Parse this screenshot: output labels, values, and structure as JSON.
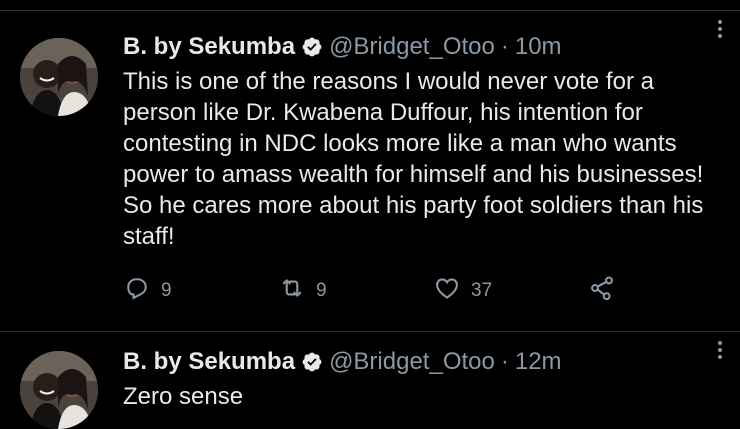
{
  "tweets": [
    {
      "display_name": "B. by Sekumba",
      "handle": "@Bridget_Otoo",
      "separator": "·",
      "time": "10m",
      "text": "This is one of the reasons I would never vote for a person like Dr. Kwabena Duffour, his intention for contesting in NDC looks more like a man who wants power to amass wealth for himself and his businesses! So he cares more about his party foot soldiers than his staff!",
      "replies": "9",
      "retweets": "9",
      "likes": "37"
    },
    {
      "display_name": "B. by Sekumba",
      "handle": "@Bridget_Otoo",
      "separator": "·",
      "time": "12m",
      "text": "Zero sense"
    }
  ],
  "colors": {
    "background": "#000000",
    "text": "#e7e9ea",
    "muted": "#8b98a5",
    "divider": "#2f3336",
    "verified_badge": "#e7e9ea"
  },
  "icons": [
    "verified-icon",
    "more-icon",
    "reply-icon",
    "retweet-icon",
    "like-icon",
    "share-icon"
  ]
}
